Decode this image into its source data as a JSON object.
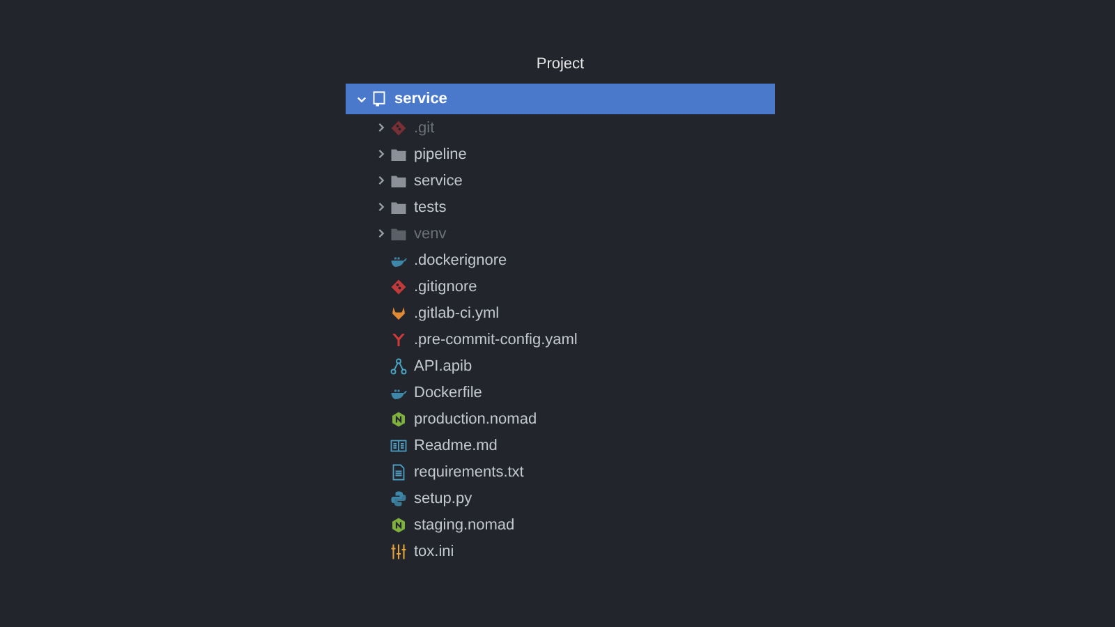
{
  "panel": {
    "title": "Project"
  },
  "tree": [
    {
      "label": "service",
      "kind": "repo",
      "expanded": true,
      "selected": true,
      "dimmed": false,
      "children": [
        {
          "label": ".git",
          "kind": "git-folder",
          "expanded": false,
          "selected": false,
          "dimmed": true
        },
        {
          "label": "pipeline",
          "kind": "folder",
          "expanded": false,
          "selected": false,
          "dimmed": false
        },
        {
          "label": "service",
          "kind": "folder",
          "expanded": false,
          "selected": false,
          "dimmed": false
        },
        {
          "label": "tests",
          "kind": "folder",
          "expanded": false,
          "selected": false,
          "dimmed": false
        },
        {
          "label": "venv",
          "kind": "folder",
          "expanded": false,
          "selected": false,
          "dimmed": true
        },
        {
          "label": ".dockerignore",
          "kind": "docker",
          "selected": false,
          "dimmed": false
        },
        {
          "label": ".gitignore",
          "kind": "git",
          "selected": false,
          "dimmed": false
        },
        {
          "label": ".gitlab-ci.yml",
          "kind": "gitlab",
          "selected": false,
          "dimmed": false
        },
        {
          "label": ".pre-commit-config.yaml",
          "kind": "yaml",
          "selected": false,
          "dimmed": false
        },
        {
          "label": "API.apib",
          "kind": "apib",
          "selected": false,
          "dimmed": false
        },
        {
          "label": "Dockerfile",
          "kind": "docker",
          "selected": false,
          "dimmed": false
        },
        {
          "label": "production.nomad",
          "kind": "nomad",
          "selected": false,
          "dimmed": false
        },
        {
          "label": "Readme.md",
          "kind": "readme",
          "selected": false,
          "dimmed": false
        },
        {
          "label": "requirements.txt",
          "kind": "text",
          "selected": false,
          "dimmed": false
        },
        {
          "label": "setup.py",
          "kind": "python",
          "selected": false,
          "dimmed": false
        },
        {
          "label": "staging.nomad",
          "kind": "nomad",
          "selected": false,
          "dimmed": false
        },
        {
          "label": "tox.ini",
          "kind": "ini",
          "selected": false,
          "dimmed": false
        }
      ]
    }
  ]
}
